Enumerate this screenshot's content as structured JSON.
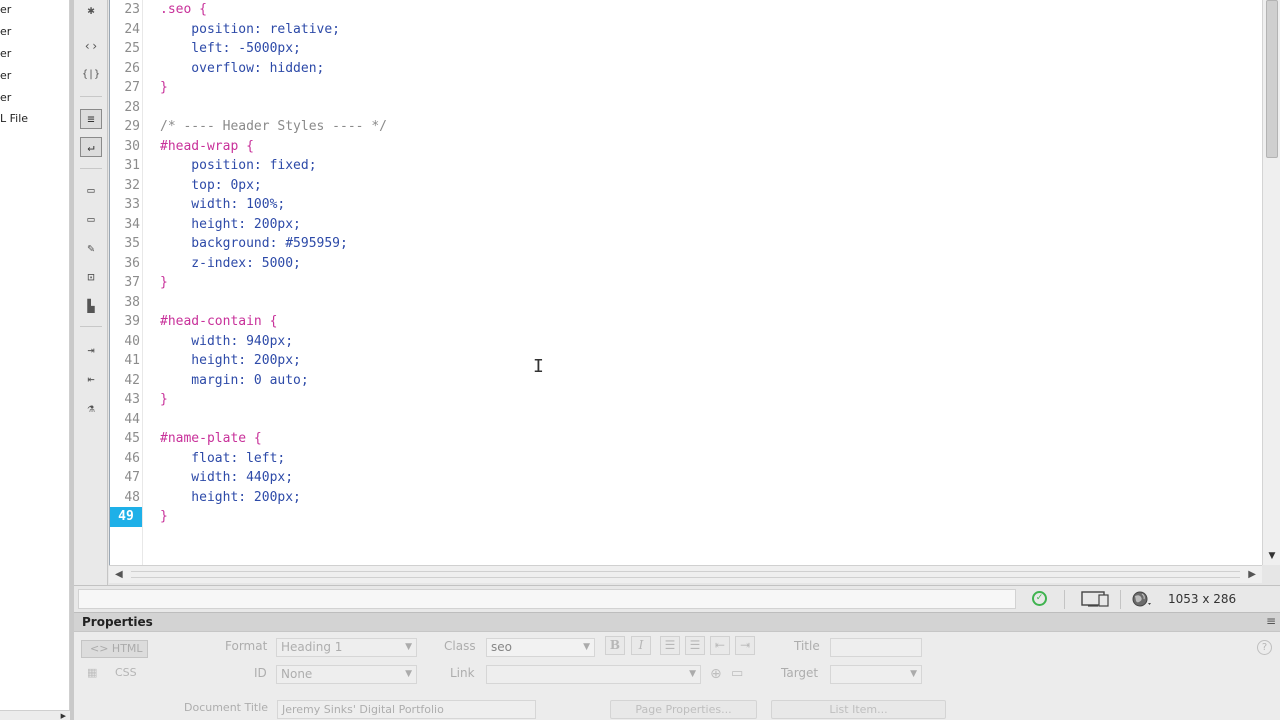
{
  "file_panel": {
    "items": [
      "er",
      "er",
      "er",
      "er",
      "er",
      "L File"
    ]
  },
  "coding_toolbar": {
    "icons": [
      {
        "name": "collapse-full-tag-icon",
        "glyph": "✱"
      },
      {
        "name": "select-parent-tag-icon",
        "glyph": "‹›"
      },
      {
        "name": "balance-braces-icon",
        "glyph": "{|}"
      },
      {
        "name": "line-numbers-icon",
        "glyph": "≡"
      },
      {
        "name": "word-wrap-icon",
        "glyph": "↵"
      },
      {
        "name": "apply-comment-icon",
        "glyph": "▭"
      },
      {
        "name": "remove-comment-icon",
        "glyph": "▭"
      },
      {
        "name": "wrap-tag-icon",
        "glyph": "✎"
      },
      {
        "name": "recent-snippets-icon",
        "glyph": "⊡"
      },
      {
        "name": "move-css-icon",
        "glyph": "▙"
      },
      {
        "name": "indent-code-icon",
        "glyph": "⇥"
      },
      {
        "name": "outdent-code-icon",
        "glyph": "⇤"
      },
      {
        "name": "format-source-icon",
        "glyph": "⚗"
      }
    ]
  },
  "editor": {
    "active_line": "49",
    "lines": [
      {
        "n": "23",
        "parts": [
          {
            "t": ".seo {",
            "c": "sel"
          }
        ]
      },
      {
        "n": "24",
        "parts": [
          {
            "t": "    position: relative;",
            "c": "prop"
          }
        ]
      },
      {
        "n": "25",
        "parts": [
          {
            "t": "    left: -5000px;",
            "c": "prop"
          }
        ]
      },
      {
        "n": "26",
        "parts": [
          {
            "t": "    overflow: hidden;",
            "c": "prop"
          }
        ]
      },
      {
        "n": "27",
        "parts": [
          {
            "t": "}",
            "c": "sel"
          }
        ]
      },
      {
        "n": "28",
        "parts": []
      },
      {
        "n": "29",
        "parts": [
          {
            "t": "/* ---- Header Styles ---- */",
            "c": "cmt"
          }
        ]
      },
      {
        "n": "30",
        "parts": [
          {
            "t": "#head-wrap {",
            "c": "sel"
          }
        ]
      },
      {
        "n": "31",
        "parts": [
          {
            "t": "    position: fixed;",
            "c": "prop"
          }
        ]
      },
      {
        "n": "32",
        "parts": [
          {
            "t": "    top: 0px;",
            "c": "prop"
          }
        ]
      },
      {
        "n": "33",
        "parts": [
          {
            "t": "    width: 100%;",
            "c": "prop"
          }
        ]
      },
      {
        "n": "34",
        "parts": [
          {
            "t": "    height: 200px;",
            "c": "prop"
          }
        ]
      },
      {
        "n": "35",
        "parts": [
          {
            "t": "    background: #595959;",
            "c": "prop"
          }
        ]
      },
      {
        "n": "36",
        "parts": [
          {
            "t": "    z-index: 5000;",
            "c": "prop"
          }
        ]
      },
      {
        "n": "37",
        "parts": [
          {
            "t": "}",
            "c": "sel"
          }
        ]
      },
      {
        "n": "38",
        "parts": []
      },
      {
        "n": "39",
        "parts": [
          {
            "t": "#head-contain {",
            "c": "sel"
          }
        ]
      },
      {
        "n": "40",
        "parts": [
          {
            "t": "    width: 940px;",
            "c": "prop"
          }
        ]
      },
      {
        "n": "41",
        "parts": [
          {
            "t": "    height: 200px;",
            "c": "prop"
          }
        ]
      },
      {
        "n": "42",
        "parts": [
          {
            "t": "    margin: 0 auto;",
            "c": "prop"
          }
        ]
      },
      {
        "n": "43",
        "parts": [
          {
            "t": "}",
            "c": "sel"
          }
        ]
      },
      {
        "n": "44",
        "parts": []
      },
      {
        "n": "45",
        "parts": [
          {
            "t": "#name-plate {",
            "c": "sel"
          }
        ]
      },
      {
        "n": "46",
        "parts": [
          {
            "t": "    float: left;",
            "c": "prop"
          }
        ]
      },
      {
        "n": "47",
        "parts": [
          {
            "t": "    width: 440px;",
            "c": "prop"
          }
        ]
      },
      {
        "n": "48",
        "parts": [
          {
            "t": "    height: 200px;",
            "c": "prop"
          }
        ]
      },
      {
        "n": "49",
        "parts": [
          {
            "t": "}",
            "c": "sel"
          }
        ]
      }
    ],
    "cursor_glyph": "I"
  },
  "status_bar": {
    "window_size": "1053 x 286",
    "ok_glyph": "✓"
  },
  "properties": {
    "title": "Properties",
    "menu_glyph": "≡",
    "html_label": "<> HTML",
    "css_label": "CSS",
    "format_label": "Format",
    "format_value": "Heading 1",
    "id_label": "ID",
    "id_value": "None",
    "class_label": "Class",
    "class_value": "seo",
    "link_label": "Link",
    "link_value": "",
    "title_label": "Title",
    "title_value": "",
    "target_label": "Target",
    "target_value": "",
    "bold_label": "B",
    "italic_label": "I",
    "doc_title_label": "Document Title",
    "doc_title_value": "Jeremy Sinks' Digital Portfolio",
    "page_properties_label": "Page Properties...",
    "list_item_label": "List Item...",
    "help_glyph": "?"
  },
  "colors": {
    "active_line_bg": "#1eb0e8",
    "selector": "#c8319a",
    "property": "#2d4aa8",
    "comment": "#8a8a8a",
    "status_ok": "#3fb34f"
  }
}
